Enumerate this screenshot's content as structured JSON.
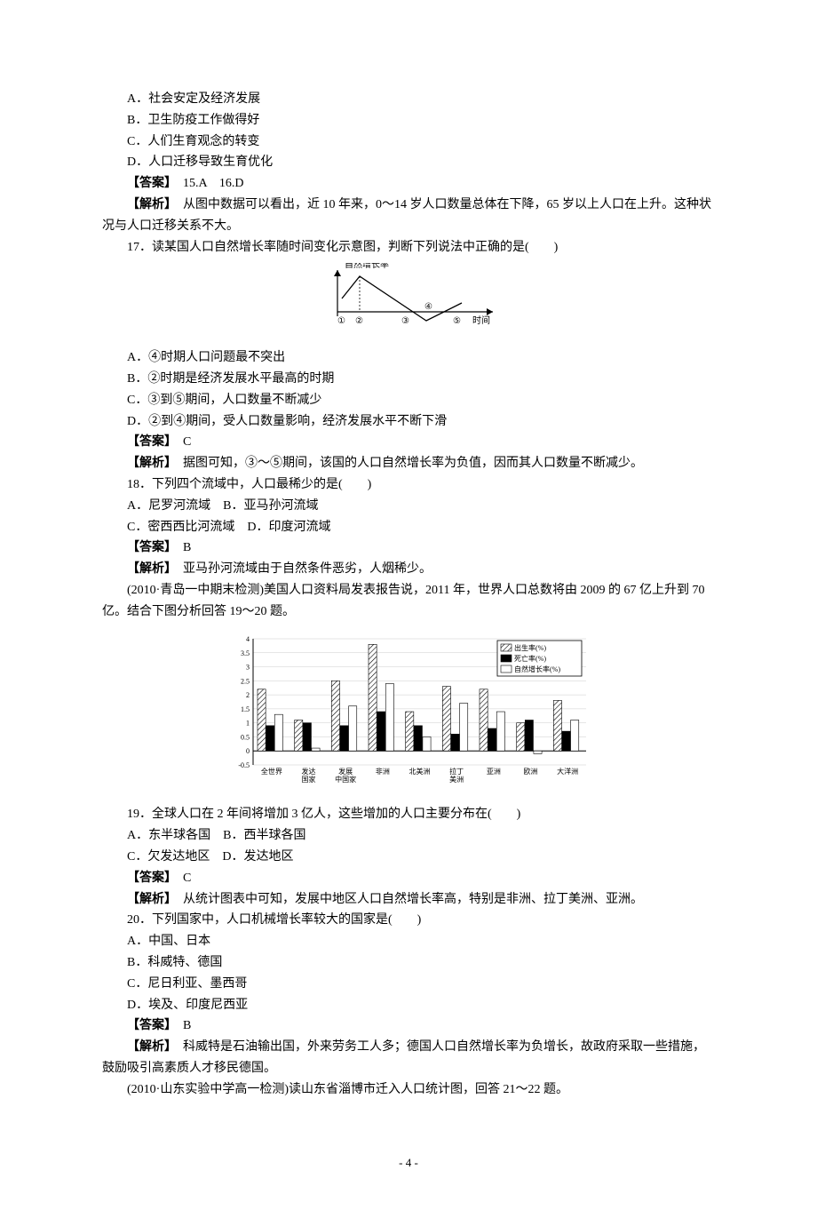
{
  "q15_16": {
    "opt_a": "A．社会安定及经济发展",
    "opt_b": "B．卫生防疫工作做得好",
    "opt_c": "C．人们生育观念的转变",
    "opt_d": "D．人口迁移导致生育优化",
    "ans_label": "【答案】",
    "ans_text": "15.A　16.D",
    "exp_label": "【解析】",
    "exp_text": "从图中数据可以看出，近 10 年来，0～14 岁人口数量总体在下降，65 岁以上人口在上升。这种状况与人口迁移关系不大。"
  },
  "q17": {
    "stem": "17．读某国人口自然增长率随时间变化示意图，判断下列说法中正确的是(　　)",
    "opt_a": "A．④时期人口问题最不突出",
    "opt_b": "B．②时期是经济发展水平最高的时期",
    "opt_c": "C．③到⑤期间，人口数量不断减少",
    "opt_d": "D．②到④期间，受人口数量影响，经济发展水平不断下滑",
    "ans_label": "【答案】",
    "ans_text": "C",
    "exp_label": "【解析】",
    "exp_text": "据图可知，③～⑤期间，该国的人口自然增长率为负值，因而其人口数量不断减少。",
    "axis_y": "自然增长率",
    "axis_x": "时间",
    "ticks": [
      "①",
      "②",
      "③",
      "④",
      "⑤"
    ]
  },
  "q18": {
    "stem": "18．下列四个流域中，人口最稀少的是(　　)",
    "opt_a": "A．尼罗河流域",
    "opt_b": "B．亚马孙河流域",
    "opt_c": "C．密西西比河流域",
    "opt_d": "D．印度河流域",
    "ans_label": "【答案】",
    "ans_text": "B",
    "exp_label": "【解析】",
    "exp_text": "亚马孙河流域由于自然条件恶劣，人烟稀少。"
  },
  "passage1": "(2010·青岛一中期末检测)美国人口资料局发表报告说，2011 年，世界人口总数将由 2009 的 67 亿上升到 70 亿。结合下图分析回答 19～20 题。",
  "chart_data": {
    "type": "bar",
    "categories": [
      "全世界",
      "发达国家",
      "发展中国家",
      "非洲",
      "北美洲",
      "拉丁美洲",
      "亚洲",
      "欧洲",
      "大洋洲"
    ],
    "series": [
      {
        "name": "出生率(%)",
        "values": [
          2.2,
          1.1,
          2.5,
          3.8,
          1.4,
          2.3,
          2.2,
          1.0,
          1.8
        ]
      },
      {
        "name": "死亡率(%)",
        "values": [
          0.9,
          1.0,
          0.9,
          1.4,
          0.9,
          0.6,
          0.8,
          1.1,
          0.7
        ]
      },
      {
        "name": "自然增长率(%)",
        "values": [
          1.3,
          0.1,
          1.6,
          2.4,
          0.5,
          1.7,
          1.4,
          -0.1,
          1.1
        ]
      }
    ],
    "ylim": [
      -0.5,
      4
    ],
    "yticks": [
      -0.5,
      0,
      0.5,
      1,
      1.5,
      2,
      2.5,
      3,
      3.5,
      4
    ],
    "legend": [
      "出生率(%)",
      "死亡率(%)",
      "自然增长率(%)"
    ]
  },
  "q19": {
    "stem": "19．全球人口在 2 年间将增加 3 亿人，这些增加的人口主要分布在(　　)",
    "opt_a": "A．东半球各国",
    "opt_b": "B．西半球各国",
    "opt_c": "C．欠发达地区",
    "opt_d": "D．发达地区",
    "ans_label": "【答案】",
    "ans_text": "C",
    "exp_label": "【解析】",
    "exp_text": "从统计图表中可知，发展中地区人口自然增长率高，特别是非洲、拉丁美洲、亚洲。"
  },
  "q20": {
    "stem": "20．下列国家中，人口机械增长率较大的国家是(　　)",
    "opt_a": "A．中国、日本",
    "opt_b": "B．科威特、德国",
    "opt_c": "C．尼日利亚、墨西哥",
    "opt_d": "D．埃及、印度尼西亚",
    "ans_label": "【答案】",
    "ans_text": "B",
    "exp_label": "【解析】",
    "exp_text": "科威特是石油输出国，外来劳务工人多；德国人口自然增长率为负增长，故政府采取一些措施，鼓励吸引高素质人才移民德国。"
  },
  "passage2": "(2010·山东实验中学高一检测)读山东省淄博市迁入人口统计图，回答 21～22 题。",
  "page_number": "- 4 -"
}
